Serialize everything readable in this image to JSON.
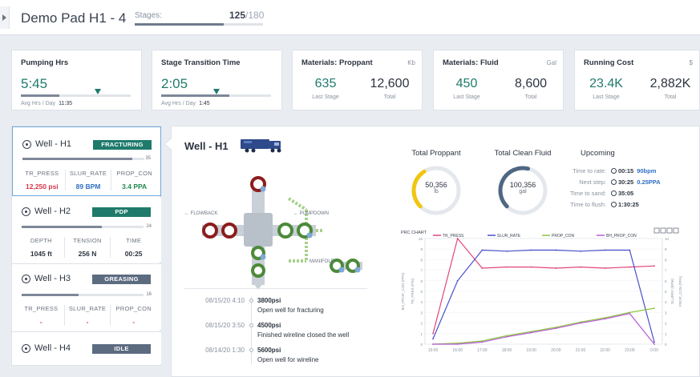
{
  "header": {
    "pad_title": "Demo Pad H1 - 4",
    "stages_label": "Stages:",
    "stages_done": "125",
    "stages_total": "/180",
    "stages_fraction": 0.694
  },
  "kpis": {
    "pumping": {
      "title": "Pumping Hrs",
      "value": "5:45",
      "sub_label": "Avg Hrs / Day",
      "sub_value": "11:35",
      "progress": 0.35,
      "target": 0.7
    },
    "transition": {
      "title": "Stage Transition Time",
      "value": "2:05",
      "sub_label": "Avg Hrs / Day",
      "sub_value": "1:45",
      "progress": 0.62,
      "target": 0.5
    },
    "proppant": {
      "title": "Materials: Proppant",
      "unit": "Kb",
      "last": "635",
      "last_label": "Last Stage",
      "total": "12,600",
      "total_label": "Total"
    },
    "fluid": {
      "title": "Materials: Fluid",
      "unit": "Gal",
      "last": "450",
      "last_label": "Last Stage",
      "total": "8,600",
      "total_label": "Total"
    },
    "cost": {
      "title": "Running Cost",
      "unit": "$",
      "last": "23.4K",
      "last_label": "Last Stage",
      "total": "2,882K",
      "total_label": "Total"
    }
  },
  "wells": [
    {
      "name": "Well - H1",
      "status": "FRACTURING",
      "status_color": "#1f7a6b",
      "progress": 0.9,
      "pct": "35",
      "cols": [
        {
          "h": "TR_PRESS",
          "v": "12,250 psi",
          "c": "#d9344a"
        },
        {
          "h": "SLUR_RATE",
          "v": "89 BPM",
          "c": "#2f6fc4"
        },
        {
          "h": "PROP_CON",
          "v": "3.4 PPA",
          "c": "#1f8a4c"
        }
      ]
    },
    {
      "name": "Well - H2",
      "status": "PDP",
      "status_color": "#1f7a6b",
      "progress": 0.66,
      "pct": "24",
      "cols": [
        {
          "h": "DEPTH",
          "v": "1045 ft",
          "c": "#2c3440"
        },
        {
          "h": "TENSION",
          "v": "256 N",
          "c": "#2c3440"
        },
        {
          "h": "TIME",
          "v": "00:25",
          "c": "#2c3440"
        }
      ]
    },
    {
      "name": "Well - H3",
      "status": "GREASING",
      "status_color": "#5c6b80",
      "progress": 0.47,
      "pct": "16",
      "cols": [
        {
          "h": "TR_PRESS",
          "v": "-",
          "c": "#d9344a"
        },
        {
          "h": "SLUR_RATE",
          "v": "-",
          "c": "#d9344a"
        },
        {
          "h": "PROP_CON",
          "v": "-",
          "c": "#d9344a"
        }
      ]
    },
    {
      "name": "Well - H4",
      "status": "IDLE",
      "status_color": "#5c6b80"
    }
  ],
  "main": {
    "title": "Well - H1",
    "diagram": {
      "flowback": "FLOWBACK",
      "pumpdown": "PUMPDOWN",
      "manifold": "MANIFOLD"
    },
    "gauges": [
      {
        "title": "Total Proppant",
        "value": "50,356",
        "unit": "lb",
        "fraction": 0.38,
        "color": "#f2c511"
      },
      {
        "title": "Total Clean Fluid",
        "value": "100,356",
        "unit": "gal",
        "fraction": 0.55,
        "color": "#4f6782"
      }
    ],
    "upcoming": {
      "title": "Upcoming",
      "rows": [
        {
          "k": "Time to rate:",
          "t": "00:15",
          "r": "90bpm"
        },
        {
          "k": "Next step:",
          "t": "30:25",
          "r": "0.25PPA"
        },
        {
          "k": "Time to sand:",
          "t": "35:05",
          "r": ""
        },
        {
          "k": "Time to flush:",
          "t": "1:30:25",
          "r": ""
        }
      ]
    },
    "events": [
      {
        "time": "08/15/20 4:10",
        "psi": "3800psi",
        "text": "Open well for fracturing"
      },
      {
        "time": "08/15/20 3:50",
        "psi": "4500psi",
        "text": "Finished wireline closed the well"
      },
      {
        "time": "08/14/20 1:30",
        "psi": "5600psi",
        "text": "Open well for wireline"
      }
    ],
    "chart_title": "PRC CHART",
    "legend": [
      {
        "name": "TR_PRESS",
        "color": "#e0457b"
      },
      {
        "name": "SLUR_RATE",
        "color": "#4b4fc9"
      },
      {
        "name": "PROP_CON",
        "color": "#8cc63e"
      },
      {
        "name": "BH_PROP_CON",
        "color": "#b85ad6"
      }
    ],
    "axis_labels": {
      "y1": "BH_PROP_CON (PPA)",
      "y2": "TR_PRES (PSI)",
      "y3": "SLURRY (BPM)",
      "y4": "PROP_CON (PPA)"
    },
    "x_ticks": [
      "15:00",
      "16:00",
      "17:00",
      "18:00",
      "19:00",
      "20:00",
      "21:00",
      "22:00",
      "23:00",
      "0:00"
    ]
  },
  "chart_data": {
    "type": "line",
    "title": "PRC CHART",
    "x": [
      "15:00",
      "16:00",
      "17:00",
      "18:00",
      "19:00",
      "20:00",
      "21:00",
      "22:00",
      "23:00",
      "0:00"
    ],
    "series": [
      {
        "name": "TR_PRESS",
        "values": [
          1,
          10,
          7.2,
          7.3,
          7.3,
          7.2,
          7.3,
          7.2,
          7.3,
          7.4
        ]
      },
      {
        "name": "SLUR_RATE",
        "values": [
          0.5,
          6,
          8.9,
          8.8,
          8.9,
          8.9,
          8.8,
          8.9,
          8.9,
          0.2
        ]
      },
      {
        "name": "PROP_CON",
        "values": [
          0,
          0.1,
          0.3,
          0.8,
          1.2,
          1.6,
          2.1,
          2.5,
          3.0,
          3.4
        ]
      },
      {
        "name": "BH_PROP_CON",
        "values": [
          0,
          0,
          0.2,
          0.7,
          1.1,
          1.5,
          2.0,
          2.4,
          2.9,
          0
        ]
      }
    ]
  }
}
